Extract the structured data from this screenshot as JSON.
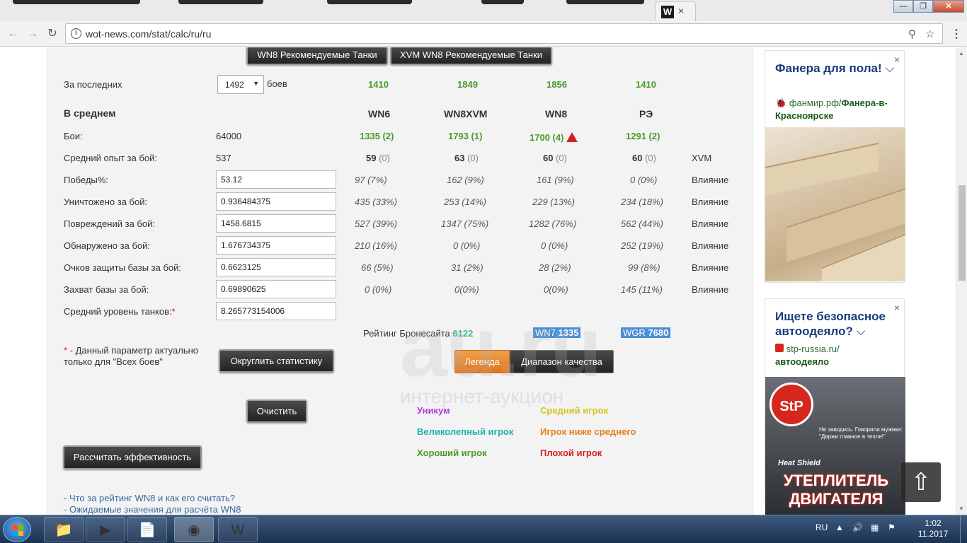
{
  "browser": {
    "tab_favicon": "W",
    "tab_close": "×",
    "url": "wot-news.com/stat/calc/ru/ru",
    "win_minimize": "—",
    "win_restore": "❐",
    "win_close": "✕"
  },
  "top_buttons": {
    "wn8_tanks": "WN8 Рекомендуемые Танки",
    "xvm_tanks": "XVM WN8 Рекомендуемые Танки"
  },
  "stats": {
    "last_label": "За последних",
    "battles_select": "1492",
    "battles_suffix": "боев",
    "top_ratings": [
      "1410",
      "1849",
      "1856",
      "1410"
    ],
    "avg_heading": "В среднем",
    "col_headers": [
      "WN6",
      "WN8XVM",
      "WN8",
      "РЭ"
    ],
    "battles_label": "Бои:",
    "battles_value": "64000",
    "battles_ratings": [
      "1335 (2)",
      "1793 (1)",
      "1700 (4)",
      "1291 (2)"
    ],
    "xp_label": "Средний опыт за бой:",
    "xp_value": "537",
    "xp_ratings": [
      {
        "v": "59",
        "d": "(0)"
      },
      {
        "v": "63",
        "d": "(0)"
      },
      {
        "v": "60",
        "d": "(0)"
      },
      {
        "v": "60",
        "d": "(0)"
      }
    ],
    "xvm_label": "XVM",
    "influence_label": "Влияние",
    "rows": [
      {
        "label": "Победы%:",
        "value": "53.12",
        "cells": [
          "97 (7%)",
          "162 (9%)",
          "161 (9%)",
          "0 (0%)"
        ]
      },
      {
        "label": "Уничтожено за бой:",
        "value": "0.936484375",
        "cells": [
          "435 (33%)",
          "253 (14%)",
          "229 (13%)",
          "234 (18%)"
        ]
      },
      {
        "label": "Повреждений за бой:",
        "value": "1458.6815",
        "cells": [
          "527 (39%)",
          "1347 (75%)",
          "1282 (76%)",
          "562 (44%)"
        ]
      },
      {
        "label": "Обнаружено за бой:",
        "value": "1.676734375",
        "cells": [
          "210 (16%)",
          "0 (0%)",
          "0 (0%)",
          "252 (19%)"
        ]
      },
      {
        "label": "Очков защиты базы за бой:",
        "value": "0.6623125",
        "cells": [
          "66 (5%)",
          "31 (2%)",
          "28 (2%)",
          "99 (8%)"
        ]
      },
      {
        "label": "Захват базы за бой:",
        "value": "0.69890625",
        "cells": [
          "0 (0%)",
          "0(0%)",
          "0(0%)",
          "145 (11%)"
        ]
      }
    ],
    "tier_label": "Средний уровень танков:",
    "asterisk": "*",
    "tier_value": "8.265773154006",
    "armor_label": "Рейтинг Бронесайта",
    "armor_value": "6122",
    "wn7_label": "WN7",
    "wn7_value": "1335",
    "wgr_label": "WGR",
    "wgr_value": "7680"
  },
  "notes": {
    "asterisk_note": "- Данный параметр актуально только для \"Всех боев\""
  },
  "buttons": {
    "round": "Округлить статистику",
    "clear": "Очистить",
    "calc": "Рассчитать эффективность",
    "legend": "Легенда",
    "quality": "Диапазон качества"
  },
  "legend": {
    "unicum": "Уникум",
    "great": "Великолепный игрок",
    "good": "Хороший игрок",
    "average": "Средний игрок",
    "below": "Игрок ниже среднего",
    "bad": "Плохой игрок"
  },
  "links": [
    "- Что за рейтинг WN8 и как его считать?",
    "- Ожидаемые значения для расчёта WN8"
  ],
  "ads": {
    "ad1_title": "Фанера для пола!",
    "ad1_domain": "фанмир.рф/",
    "ad1_path": "Фанера-в-Красноярске",
    "ad2_title": "Ищете безопасное автоодеяло?",
    "ad2_domain": "stp-russia.ru/",
    "ad2_path": "автоодеяло",
    "ad2_logo": "StP",
    "ad2_small": "Не заводись. Говорили мужики: \"Держи главное в тепле!\"",
    "ad2_heat": "Heat Shield",
    "ad2_big": "УТЕПЛИТЕЛЬ ДВИГАТЕЛЯ",
    "chevron": "⌵",
    "close": "×"
  },
  "watermark": {
    "main": "au.ru",
    "sub": "интернет-аукцион"
  },
  "taskbar": {
    "lang": "RU",
    "time": "1:02",
    "date": "11.2017"
  },
  "colors": {
    "green": "#4a9a2e",
    "unicum": "#b23ad6",
    "great": "#1fb3a6",
    "good": "#4a9a2e",
    "average": "#d6c51d",
    "below": "#e6801c",
    "bad": "#d42020"
  }
}
